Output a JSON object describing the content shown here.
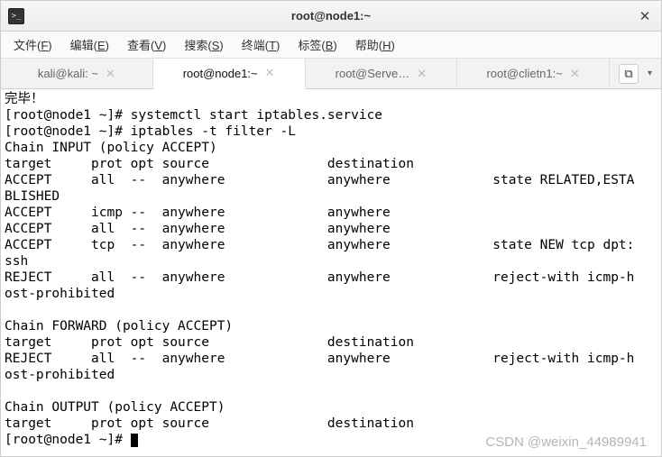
{
  "titlebar": {
    "title": "root@node1:~"
  },
  "menubar": {
    "items": [
      {
        "label": "文件",
        "accel": "F"
      },
      {
        "label": "编辑",
        "accel": "E"
      },
      {
        "label": "查看",
        "accel": "V"
      },
      {
        "label": "搜索",
        "accel": "S"
      },
      {
        "label": "终端",
        "accel": "T"
      },
      {
        "label": "标签",
        "accel": "B"
      },
      {
        "label": "帮助",
        "accel": "H"
      }
    ]
  },
  "tabs": [
    {
      "label": "kali@kali: ~",
      "active": false
    },
    {
      "label": "root@node1:~",
      "active": true
    },
    {
      "label": "root@Serve…",
      "active": false
    },
    {
      "label": "root@clietn1:~",
      "active": false
    }
  ],
  "newtab_icon": "⧉",
  "terminal_lines": [
    "完毕！",
    "[root@node1 ~]# systemctl start iptables.service",
    "[root@node1 ~]# iptables -t filter -L",
    "Chain INPUT (policy ACCEPT)",
    "target     prot opt source               destination         ",
    "ACCEPT     all  --  anywhere             anywhere             state RELATED,ESTA",
    "BLISHED",
    "ACCEPT     icmp --  anywhere             anywhere            ",
    "ACCEPT     all  --  anywhere             anywhere            ",
    "ACCEPT     tcp  --  anywhere             anywhere             state NEW tcp dpt:",
    "ssh",
    "REJECT     all  --  anywhere             anywhere             reject-with icmp-h",
    "ost-prohibited",
    "",
    "Chain FORWARD (policy ACCEPT)",
    "target     prot opt source               destination         ",
    "REJECT     all  --  anywhere             anywhere             reject-with icmp-h",
    "ost-prohibited",
    "",
    "Chain OUTPUT (policy ACCEPT)",
    "target     prot opt source               destination         ",
    "[root@node1 ~]# "
  ],
  "prompt_cursor": "█",
  "watermark": "CSDN @weixin_44989941"
}
